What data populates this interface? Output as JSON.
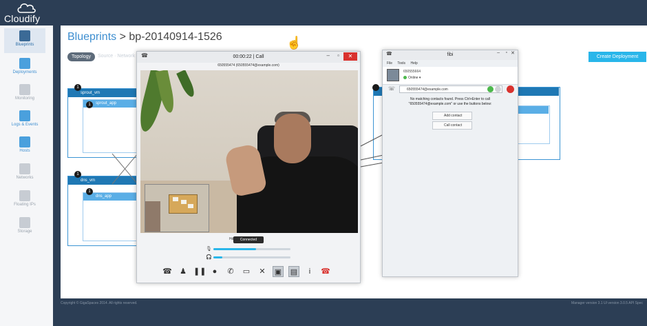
{
  "app": {
    "logo_text": "Cloudify"
  },
  "sidebar": {
    "items": [
      {
        "label": "Blueprints"
      },
      {
        "label": "Deployments"
      },
      {
        "label": "Monitoring"
      },
      {
        "label": "Logs & Events"
      },
      {
        "label": "Hosts"
      },
      {
        "label": "Networks"
      },
      {
        "label": "Floating IPs"
      },
      {
        "label": "Storage"
      }
    ]
  },
  "main": {
    "breadcrumb_root": "Blueprints",
    "breadcrumb_current": "> bp-20140914-1526",
    "tab_topology": "Topology",
    "tab_other": "Source · Network",
    "create_button": "Create Deployment",
    "nodes": [
      {
        "name": "sprout_vm",
        "badge": "1",
        "inner": "sprout_app",
        "inner_badge": "1"
      },
      {
        "name": "dns_vm",
        "badge": "1",
        "inner": "dns_app",
        "inner_badge": "1"
      }
    ]
  },
  "footer": {
    "left": "Copyright © GigaSpaces 2014. All rights reserved.",
    "right": "Manager version 3.1    UI version 3.0.5    API Spec"
  },
  "call_window": {
    "title": "00:00:22 | Call",
    "address": "650555474 (650555474@example.com)",
    "status": "Connected",
    "status_prefix": "Hd",
    "mic_level": 0.55,
    "speaker_level": 0.12,
    "toolbar": [
      {
        "icon": "transfer-icon",
        "glyph": "☎"
      },
      {
        "icon": "person-icon",
        "glyph": "♟"
      },
      {
        "icon": "pause-icon",
        "glyph": "❚❚"
      },
      {
        "icon": "record-icon",
        "glyph": "●"
      },
      {
        "icon": "phone-add-icon",
        "glyph": "✆"
      },
      {
        "icon": "screen-icon",
        "glyph": "▭"
      },
      {
        "icon": "disconnect-icon",
        "glyph": "✕"
      },
      {
        "icon": "video-icon",
        "glyph": "▣"
      },
      {
        "icon": "picture-icon",
        "glyph": "▤"
      },
      {
        "icon": "info-icon",
        "glyph": "i"
      },
      {
        "icon": "hangup-icon",
        "glyph": "☎"
      }
    ]
  },
  "contacts_window": {
    "title": "fibi",
    "menu": [
      "File",
      "Tools",
      "Help"
    ],
    "user_name": "650555664",
    "user_status": "Online",
    "search_value": "650555474@example.com",
    "message_line1": "No matching contacts found. Press Ctrl+Enter to call",
    "message_line2": "\"650555474@example.com\" or use the buttons below:",
    "add_contact": "Add contact",
    "call_contact": "Call contact"
  }
}
